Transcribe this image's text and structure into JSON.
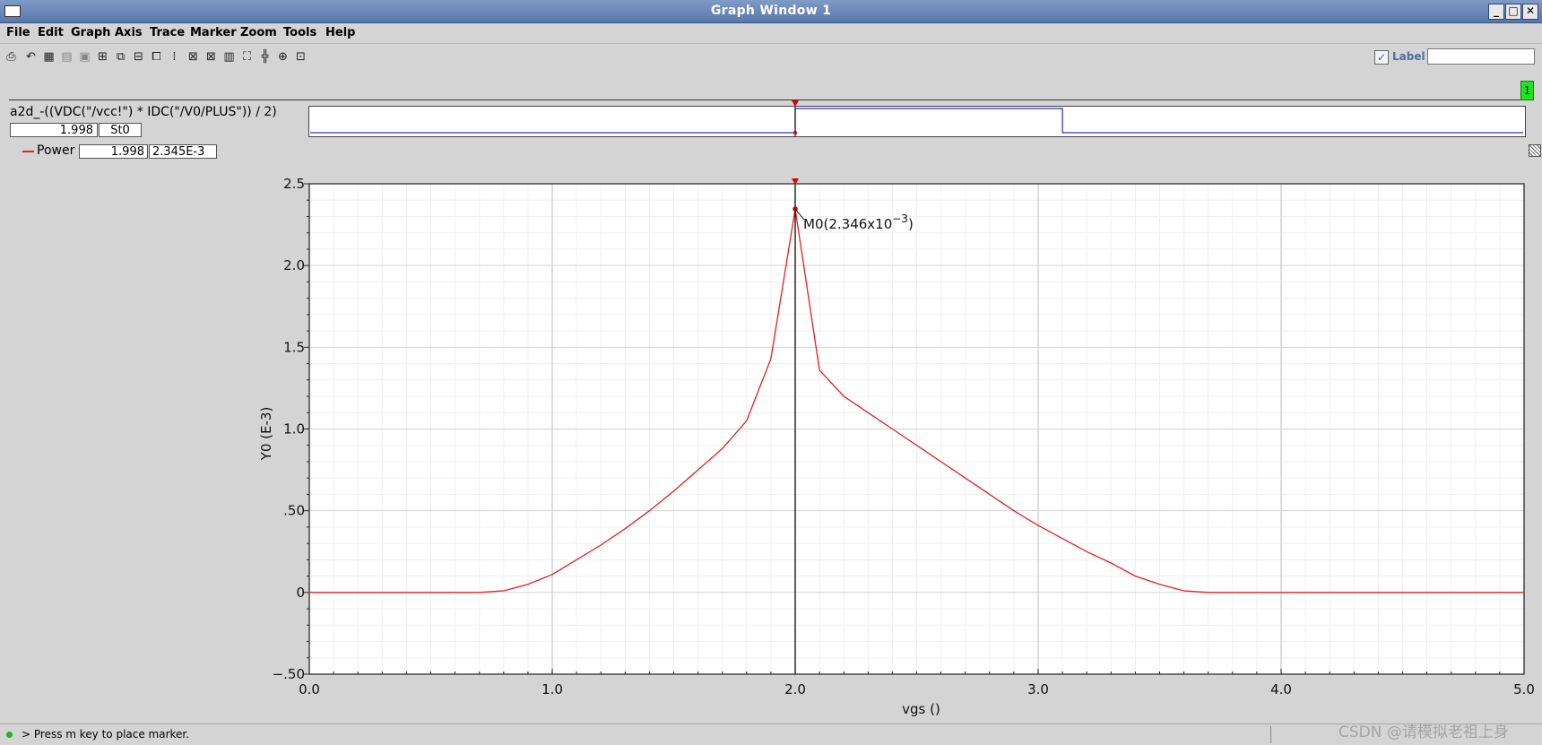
{
  "window": {
    "title": "Graph Window 1",
    "buttons": [
      "_",
      "□",
      "✕"
    ]
  },
  "menu": [
    "File",
    "Edit",
    "Graph",
    "Axis",
    "Trace",
    "Marker",
    "Zoom",
    "Tools",
    "Help"
  ],
  "toolbar": {
    "icons": [
      "print-icon",
      "undo-icon",
      "grid-icon",
      "strip-icon",
      "strip2-icon",
      "zoom-fit-icon",
      "zoom-in-icon",
      "zoom-out-icon",
      "zoom-x-icon",
      "zoom-y-icon",
      "marker-icon",
      "delta-marker-icon",
      "calculator-icon",
      "fit-icon",
      "xfit-icon",
      "yfit-icon",
      "extents-icon"
    ],
    "label_checkbox": "Label",
    "label_checked": true,
    "label_input_value": ""
  },
  "strip": {
    "number": "1"
  },
  "digital": {
    "expression": "a2d_-((VDC(\"/vcc!\") * IDC(\"/V0/PLUS\")) / 2)",
    "x_value": "1.998",
    "state": "St0"
  },
  "legend": {
    "name": "Power",
    "x_value": "1.998",
    "y_value": "2.345E-3",
    "color": "#e02020"
  },
  "status": {
    "message": "> Press m key to place marker."
  },
  "watermark": "CSDN @请模拟老祖上身",
  "chart_data": {
    "type": "line",
    "xlabel": "vgs ()",
    "ylabel": "Y0 (E-3)",
    "xlim": [
      0.0,
      5.0
    ],
    "ylim": [
      -0.5,
      2.5
    ],
    "xticks": [
      "0.0",
      "1.0",
      "2.0",
      "3.0",
      "4.0",
      "5.0"
    ],
    "yticks": [
      "−.50",
      "0",
      ".50",
      "1.0",
      "1.5",
      "2.0",
      "2.5"
    ],
    "grid": true,
    "series": [
      {
        "name": "Power",
        "color": "#e02020",
        "x": [
          0.0,
          0.7,
          0.8,
          0.9,
          1.0,
          1.1,
          1.2,
          1.3,
          1.4,
          1.5,
          1.6,
          1.7,
          1.8,
          1.9,
          2.0,
          2.1,
          2.2,
          2.3,
          2.4,
          2.5,
          2.6,
          2.7,
          2.8,
          2.9,
          3.0,
          3.1,
          3.2,
          3.3,
          3.4,
          3.5,
          3.6,
          3.7,
          3.8,
          3.9,
          4.0,
          4.1,
          5.0
        ],
        "y": [
          0,
          0,
          0.01,
          0.05,
          0.11,
          0.2,
          0.29,
          0.39,
          0.5,
          0.62,
          0.75,
          0.88,
          1.05,
          1.43,
          2.346,
          1.36,
          1.2,
          1.1,
          1.0,
          0.9,
          0.8,
          0.7,
          0.6,
          0.5,
          0.41,
          0.33,
          0.25,
          0.18,
          0.1,
          0.05,
          0.01,
          0,
          0,
          0,
          0,
          0,
          0
        ]
      }
    ],
    "marker": {
      "x": 2.0,
      "y": 2.346,
      "label_prefix": "M0(2.346x10",
      "label_exp": "−3",
      "label_suffix": ")"
    },
    "digital_wave": {
      "low_to_high": 2.0,
      "high_to_low": 3.1,
      "color": "#2a2acc"
    }
  }
}
